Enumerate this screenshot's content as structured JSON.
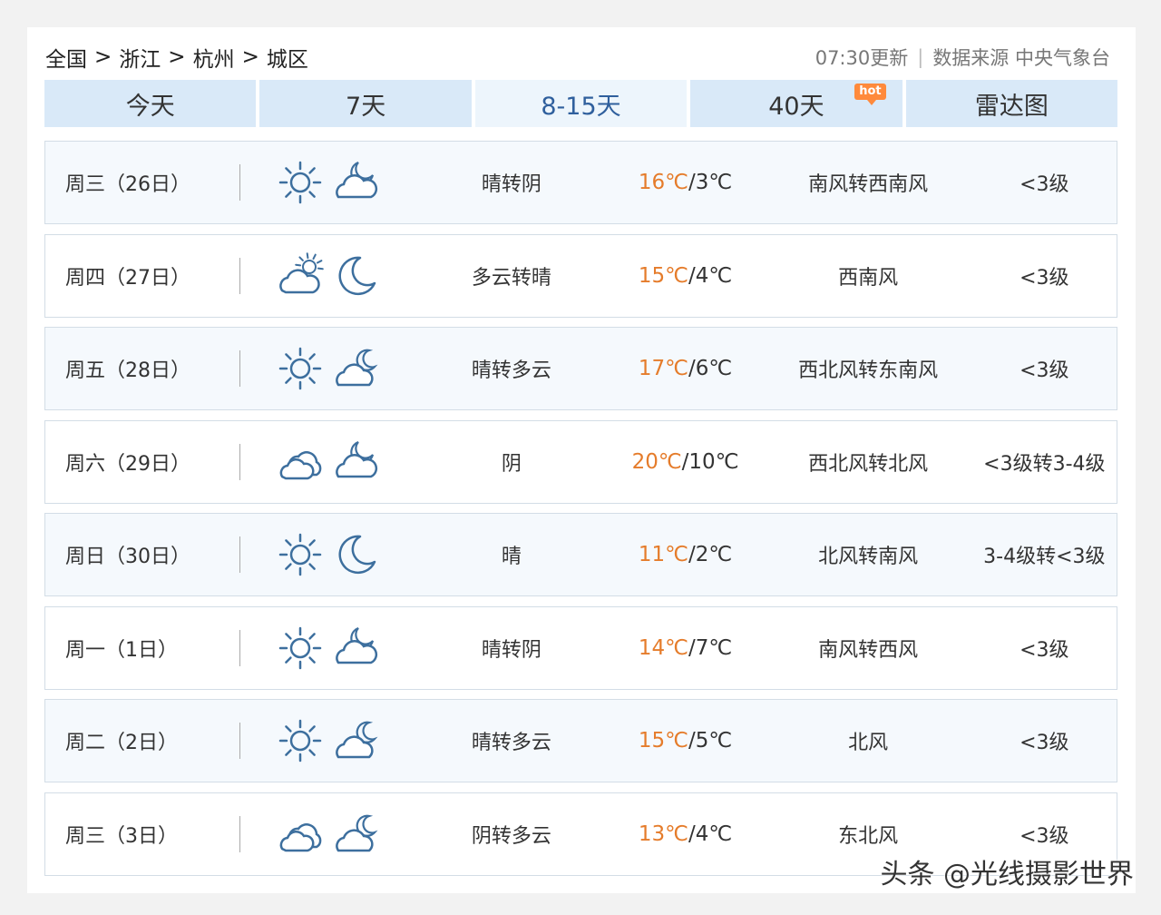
{
  "breadcrumb": [
    "全国",
    "浙江",
    "杭州",
    "城区"
  ],
  "breadcrumb_sep": ">",
  "update_time": "07:30更新",
  "data_source": "数据来源 中央气象台",
  "tabs": [
    {
      "label": "今天",
      "active": false
    },
    {
      "label": "7天",
      "active": false
    },
    {
      "label": "8-15天",
      "active": true
    },
    {
      "label": "40天",
      "active": false,
      "badge": "hot"
    },
    {
      "label": "雷达图",
      "active": false
    }
  ],
  "colors": {
    "accent": "#2f5f9d",
    "high_temp": "#e57c2b",
    "tab_bg": "#d9e9f8",
    "badge": "#ff8a3c"
  },
  "forecast": [
    {
      "date": "周三（26日）",
      "day_icon": "sunny-icon",
      "night_icon": "cloudy-night-icon",
      "desc": "晴转阴",
      "high": "16℃",
      "low": "/3℃",
      "wind": "南风转西南风",
      "level": "<3级"
    },
    {
      "date": "周四（27日）",
      "day_icon": "partly-cloudy-icon",
      "night_icon": "moon-icon",
      "desc": "多云转晴",
      "high": "15℃",
      "low": "/4℃",
      "wind": "西南风",
      "level": "<3级"
    },
    {
      "date": "周五（28日）",
      "day_icon": "sunny-icon",
      "night_icon": "cloudy-moon-icon",
      "desc": "晴转多云",
      "high": "17℃",
      "low": "/6℃",
      "wind": "西北风转东南风",
      "level": "<3级"
    },
    {
      "date": "周六（29日）",
      "day_icon": "overcast-icon",
      "night_icon": "cloudy-night-icon",
      "desc": "阴",
      "high": "20℃",
      "low": "/10℃",
      "wind": "西北风转北风",
      "level": "<3级转3-4级"
    },
    {
      "date": "周日（30日）",
      "day_icon": "sunny-icon",
      "night_icon": "moon-icon",
      "desc": "晴",
      "high": "11℃",
      "low": "/2℃",
      "wind": "北风转南风",
      "level": "3-4级转<3级"
    },
    {
      "date": "周一（1日）",
      "day_icon": "sunny-icon",
      "night_icon": "cloudy-night-icon",
      "desc": "晴转阴",
      "high": "14℃",
      "low": "/7℃",
      "wind": "南风转西风",
      "level": "<3级"
    },
    {
      "date": "周二（2日）",
      "day_icon": "sunny-icon",
      "night_icon": "cloudy-moon-icon",
      "desc": "晴转多云",
      "high": "15℃",
      "low": "/5℃",
      "wind": "北风",
      "level": "<3级"
    },
    {
      "date": "周三（3日）",
      "day_icon": "overcast-icon",
      "night_icon": "cloudy-moon-icon",
      "desc": "阴转多云",
      "high": "13℃",
      "low": "/4℃",
      "wind": "东北风",
      "level": "<3级"
    }
  ],
  "watermark": "头条 @光线摄影世界"
}
